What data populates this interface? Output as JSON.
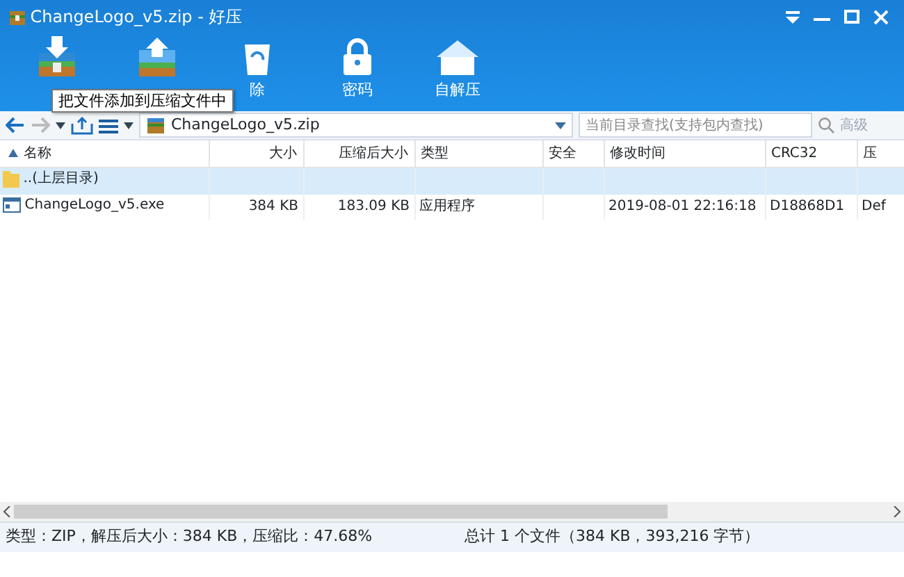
{
  "window": {
    "title": "ChangeLogo_v5.zip - 好压"
  },
  "toolbar": [
    {
      "kind": "add"
    },
    {
      "kind": "extract"
    },
    {
      "kind": "delete",
      "label": "除"
    },
    {
      "kind": "password",
      "label": "密码"
    },
    {
      "kind": "sfx",
      "label": "自解压"
    }
  ],
  "tooltip": "把文件添加到压缩文件中",
  "address": {
    "path": "ChangeLogo_v5.zip",
    "search_placeholder": "当前目录查找(支持包内查找)",
    "advanced": "高级"
  },
  "table": {
    "columns": [
      "名称",
      "大小",
      "压缩后大小",
      "类型",
      "安全",
      "修改时间",
      "CRC32",
      "压"
    ],
    "rows": [
      {
        "kind": "parent",
        "selected": true,
        "cells": [
          "..(上层目录)",
          "",
          "",
          "",
          "",
          "",
          "",
          ""
        ]
      },
      {
        "kind": "exe",
        "selected": false,
        "cells": [
          "ChangeLogo_v5.exe",
          "384 KB",
          "183.09 KB",
          "应用程序",
          "",
          "2019-08-01 22:16:18",
          "D18868D1",
          "Def"
        ]
      }
    ]
  },
  "status_bar": {
    "left": "类型：ZIP，解压后大小：384 KB，压缩比：47.68%",
    "right": "总计 1 个文件（384 KB，393,216 字节）"
  }
}
